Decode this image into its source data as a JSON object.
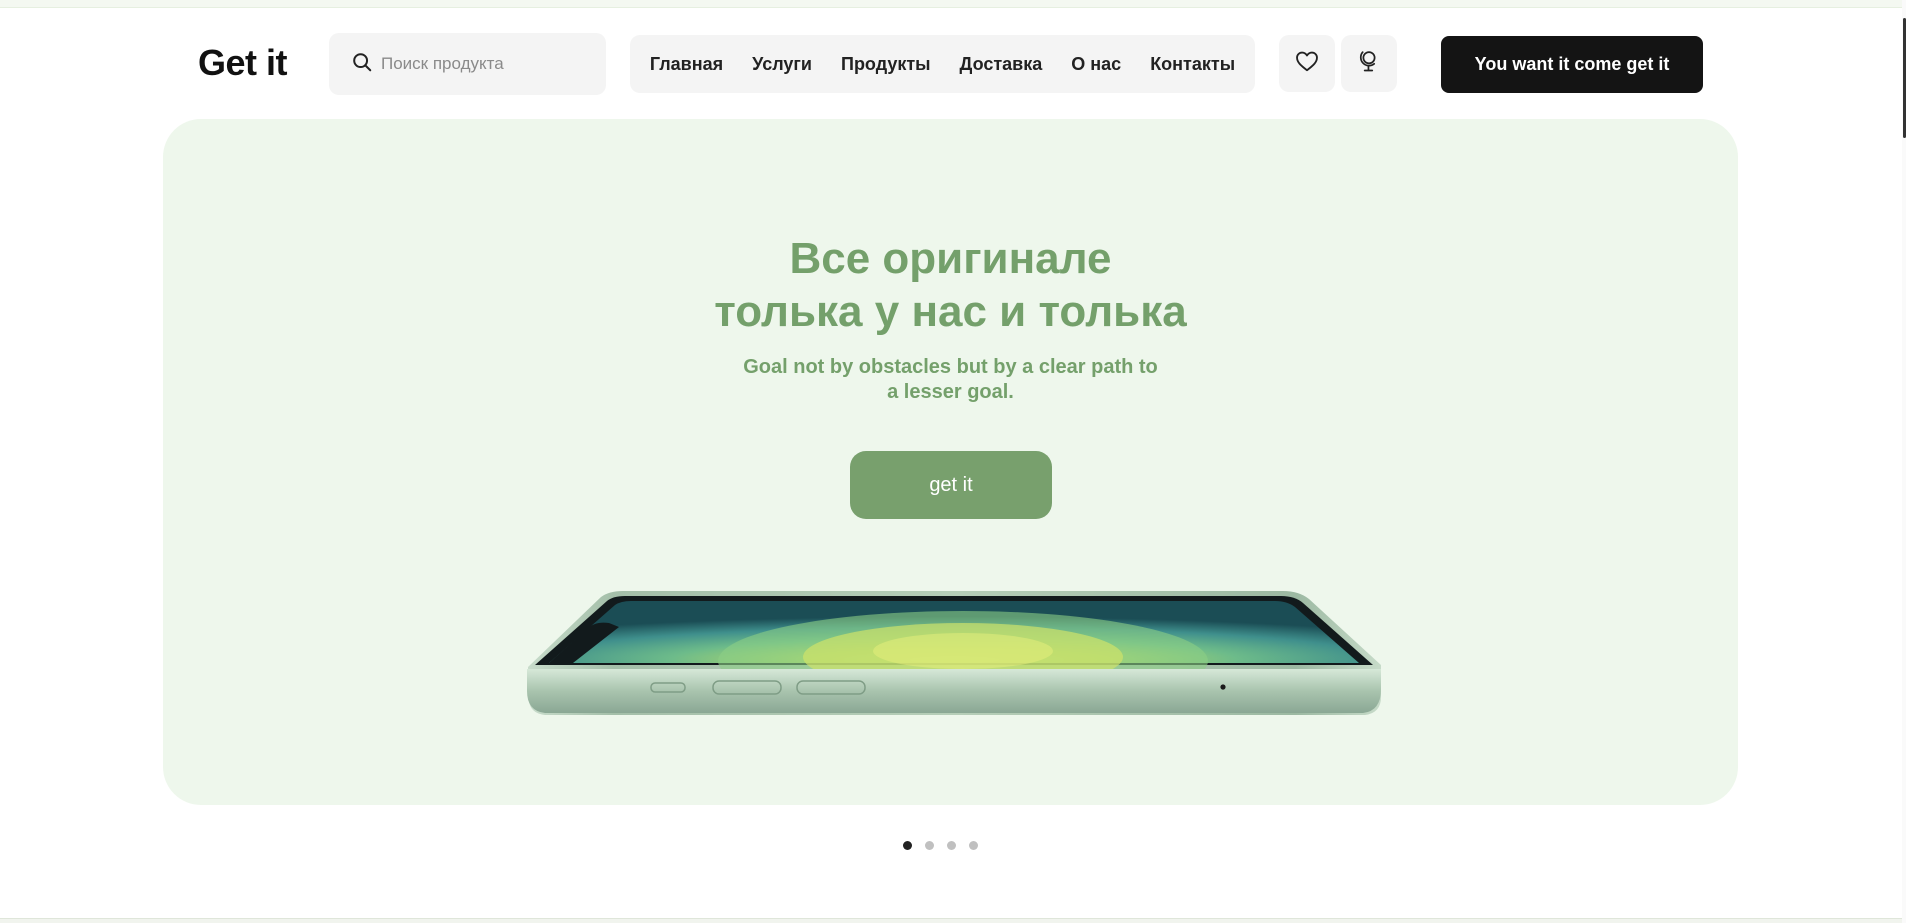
{
  "header": {
    "logo": "Get it",
    "search": {
      "placeholder": "Поиск продукта",
      "value": ""
    },
    "nav": [
      {
        "label": "Главная"
      },
      {
        "label": "Услуги"
      },
      {
        "label": "Продукты"
      },
      {
        "label": "Доставка"
      },
      {
        "label": "О нас"
      },
      {
        "label": "Контакты"
      }
    ],
    "icons": {
      "favorites": "heart-icon",
      "language": "globe-icon",
      "search": "search-icon"
    },
    "cta_label": "You want it come get it"
  },
  "hero": {
    "title_line1": "Все оригинале",
    "title_line2": "толька у нас и толька",
    "subtitle_line1": "Goal not by obstacles but by a clear path to",
    "subtitle_line2": "a lesser goal.",
    "button_label": "get it",
    "image": "green-smartphone-image"
  },
  "carousel": {
    "total": 4,
    "active": 1
  },
  "colors": {
    "accent": "#78a06d",
    "hero_bg": "#eef7ec",
    "text_green": "#74a06b",
    "cta_bg": "#141414"
  }
}
